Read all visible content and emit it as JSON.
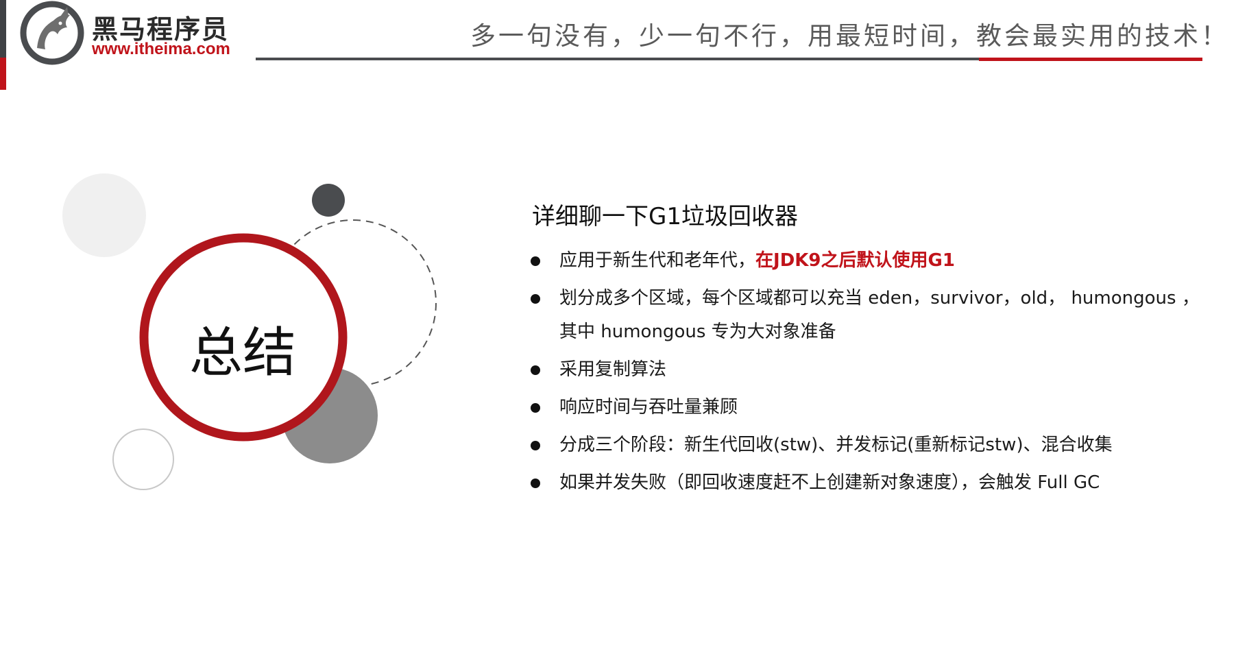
{
  "logo": {
    "name_cn": "黑马程序员",
    "url": "www.itheima.com"
  },
  "header": {
    "slogan": "多一句没有，少一句不行，用最短时间，教会最实用的技术！"
  },
  "summary": {
    "label": "总结"
  },
  "content": {
    "title": "详细聊一下G1垃圾回收器",
    "bullets": [
      {
        "text": "应用于新生代和老年代，",
        "highlight": "在JDK9之后默认使用G1"
      },
      {
        "text": "划分成多个区域，每个区域都可以充当 eden，survivor，old， humongous ，其中 humongous 专为大对象准备"
      },
      {
        "text": "采用复制算法"
      },
      {
        "text": "响应时间与吞吐量兼顾"
      },
      {
        "text": "分成三个阶段：新生代回收(stw)、并发标记(重新标记stw)、混合收集"
      },
      {
        "text": "如果并发失败（即回收速度赶不上创建新对象速度），会触发 Full GC"
      }
    ]
  },
  "colors": {
    "accent_red": "#c0131a",
    "dark_gray": "#4a4c4f",
    "mid_gray": "#8c8c8c",
    "light_gray": "#f0f0f0"
  }
}
